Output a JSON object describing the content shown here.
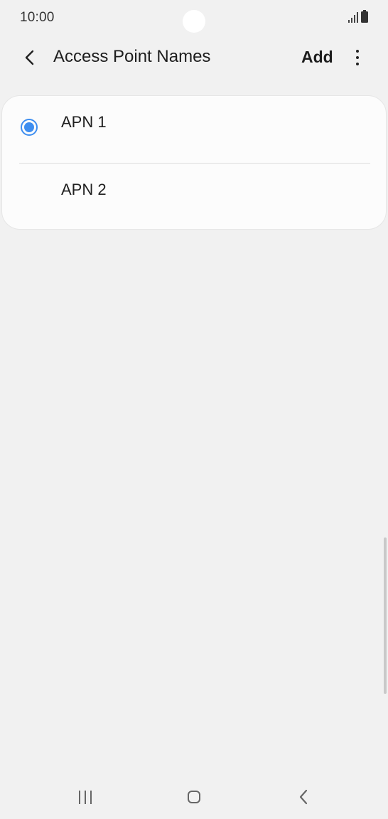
{
  "status_bar": {
    "time": "10:00",
    "icons": [
      "signal-icon",
      "battery-icon"
    ]
  },
  "app_bar": {
    "title": "Access Point Names",
    "back_icon": "chevron-left-icon",
    "add_label": "Add",
    "more_icon": "more-vertical-icon"
  },
  "apn_list": {
    "items": [
      {
        "label": "APN 1",
        "selected": true
      },
      {
        "label": "APN 2",
        "selected": false
      }
    ]
  },
  "nav_bar": {
    "recents_icon": "recents-icon",
    "home_icon": "home-icon",
    "back_icon": "back-icon"
  },
  "colors": {
    "background": "#f1f1f1",
    "card": "#fcfcfc",
    "accent": "#3e8ef0",
    "text": "#1d1d1d"
  }
}
